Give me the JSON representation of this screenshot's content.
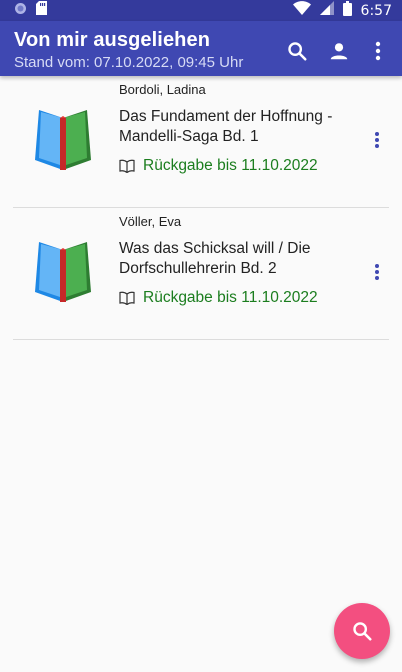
{
  "status_bar": {
    "time": "6:57"
  },
  "app_bar": {
    "title": "Von mir ausgeliehen",
    "subtitle": "Stand vom: 07.10.2022, 09:45 Uhr",
    "actions": [
      "search-icon",
      "account-icon",
      "overflow-menu-icon"
    ]
  },
  "loans": [
    {
      "author": "Bordoli, Ladina",
      "title": "Das Fundament der Hoffnung - Mandelli-Saga Bd. 1",
      "due": "Rückgabe bis 11.10.2022",
      "icon": "book-cover-icon"
    },
    {
      "author": "Völler, Eva",
      "title": "Was das Schicksal will / Die Dorfschullehrerin Bd. 2",
      "due": "Rückgabe bis 11.10.2022",
      "icon": "book-cover-icon"
    }
  ],
  "colors": {
    "status_bar": "#343a9c",
    "app_bar": "#3f48b2",
    "due_text": "#1b7d1e",
    "overflow_dots": "#3f48b2",
    "fab": "#f34f80"
  },
  "fab": {
    "icon": "search-icon"
  }
}
